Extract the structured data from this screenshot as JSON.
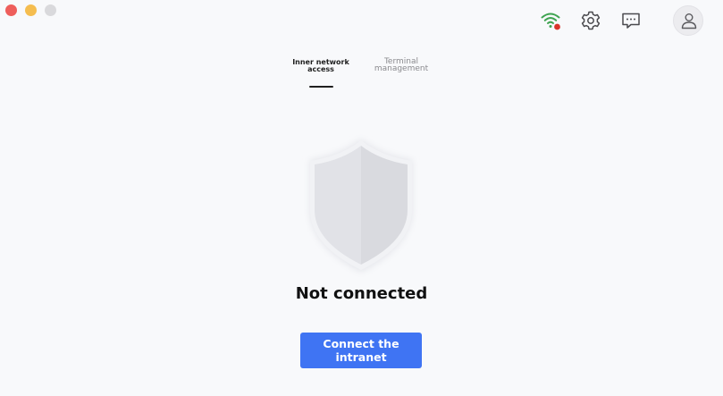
{
  "tabs": [
    {
      "label": "Inner network access",
      "active": true
    },
    {
      "label": "Terminal management",
      "active": false
    }
  ],
  "status": {
    "text": "Not connected"
  },
  "connect_button": {
    "label": "Connect the intranet"
  },
  "icons": {
    "wifi": "wifi-icon",
    "settings": "gear-icon",
    "messages": "message-icon",
    "account": "user-icon"
  },
  "colors": {
    "accent": "#3f74f3",
    "wifi": "#3fa451",
    "wifi_status_dot": "#d9342b",
    "shield": "#e3e4e8"
  }
}
